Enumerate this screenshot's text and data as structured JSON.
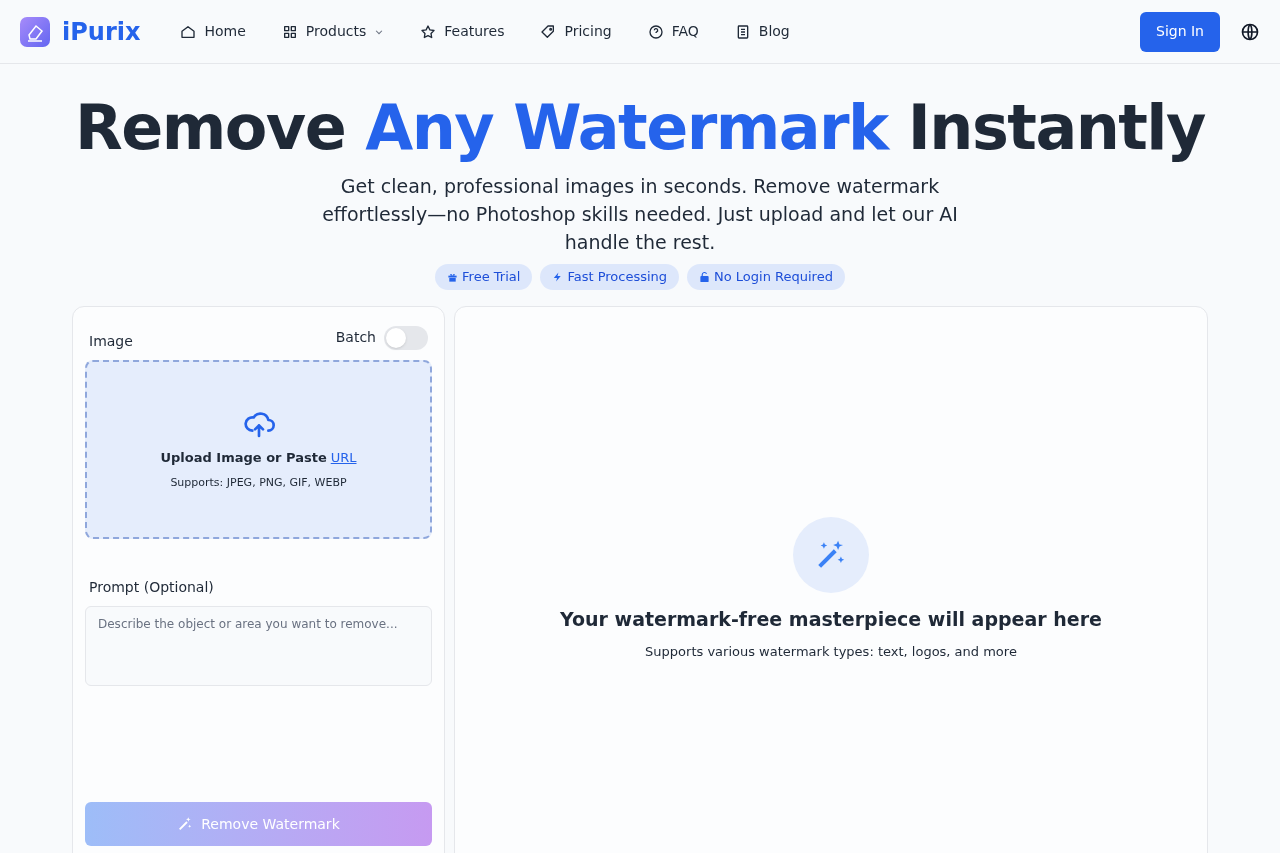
{
  "brand": "iPurix",
  "nav": [
    {
      "kind": "home",
      "label": "Home"
    },
    {
      "kind": "products",
      "label": "Products",
      "dropdown": true
    },
    {
      "kind": "features",
      "label": "Features"
    },
    {
      "kind": "pricing",
      "label": "Pricing"
    },
    {
      "kind": "faq",
      "label": "FAQ"
    },
    {
      "kind": "blog",
      "label": "Blog"
    }
  ],
  "sign_in": "Sign In",
  "hero": {
    "title_start": "Remove",
    "title_highlight": "Any Watermark",
    "title_end": "Instantly",
    "subtitle": "Get clean, professional images in seconds. Remove watermark effortlessly—no Photoshop skills needed. Just upload and let our AI handle the rest."
  },
  "badges": [
    {
      "kind": "gift",
      "label": "Free Trial"
    },
    {
      "kind": "bolt",
      "label": "Fast Processing"
    },
    {
      "kind": "lock",
      "label": "No Login Required"
    }
  ],
  "form": {
    "image_label": "Image",
    "batch_label": "Batch",
    "batch_on": false,
    "upload_text": "Upload Image or Paste",
    "upload_link": "URL",
    "upload_formats": "Supports: JPEG, PNG, GIF, WEBP",
    "prompt_label": "Prompt (Optional)",
    "prompt_placeholder": "Describe the object or area you want to remove...",
    "submit": "Remove Watermark",
    "submit_disabled": true
  },
  "result": {
    "title": "Your watermark-free masterpiece will appear here",
    "subtitle": "Supports various watermark types: text, logos, and more"
  }
}
